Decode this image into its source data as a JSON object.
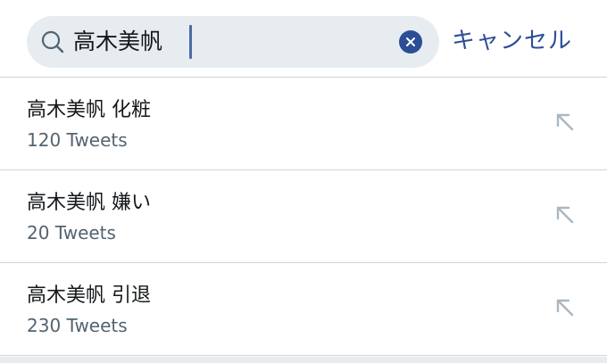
{
  "search": {
    "query": "高木美帆",
    "cancel_label": "キャンセル"
  },
  "suggestions": [
    {
      "title": "高木美帆 化粧",
      "count": "120 Tweets"
    },
    {
      "title": "高木美帆 嫌い",
      "count": "20 Tweets"
    },
    {
      "title": "高木美帆 引退",
      "count": "230 Tweets"
    }
  ],
  "colors": {
    "accent": "#2c4e97",
    "search_background": "#e6ecf0",
    "primary_text": "#14171a",
    "secondary_text": "#536471",
    "divider": "#cfd4d8",
    "arrow": "#aab8c2"
  },
  "icons": {
    "search": "search-icon",
    "clear": "close-icon",
    "fill_query": "arrow-up-left-icon"
  }
}
